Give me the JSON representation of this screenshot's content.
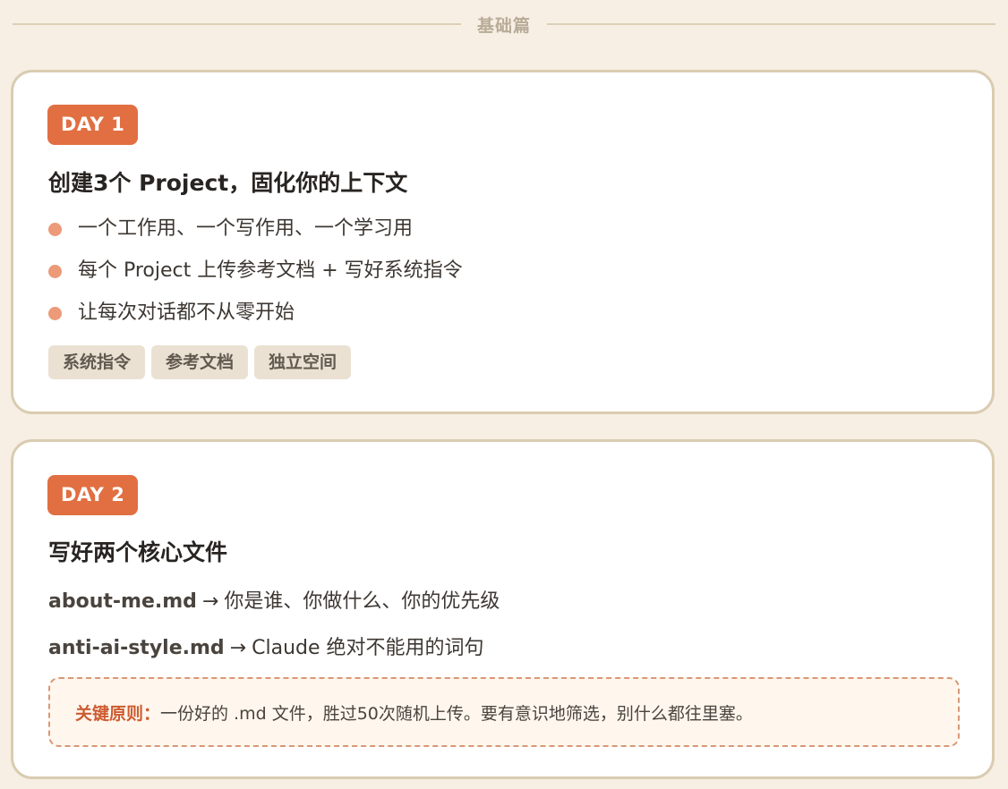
{
  "section": {
    "title": "基础篇"
  },
  "day1": {
    "badge": "DAY 1",
    "title": "创建3个 Project，固化你的上下文",
    "bullets": [
      "一个工作用、一个写作用、一个学习用",
      "每个 Project 上传参考文档 + 写好系统指令",
      "让每次对话都不从零开始"
    ],
    "tags": [
      "系统指令",
      "参考文档",
      "独立空间"
    ]
  },
  "day2": {
    "badge": "DAY 2",
    "title": "写好两个核心文件",
    "files": [
      {
        "name": "about-me.md",
        "arrow": "→",
        "desc": "你是谁、你做什么、你的优先级"
      },
      {
        "name": "anti-ai-style.md",
        "arrow": "→",
        "desc": "Claude 绝对不能用的词句"
      }
    ],
    "note": {
      "label": "关键原则：",
      "text": "一份好的 .md 文件，胜过50次随机上传。要有意识地筛选，别什么都往里塞。"
    }
  },
  "colors": {
    "background": "#f7efe3",
    "badge": "#e16f42",
    "bullet": "#ec9a78",
    "card_border": "#d9ccb1",
    "tag_bg": "#ebe1d3",
    "note_label": "#cd5c31"
  }
}
